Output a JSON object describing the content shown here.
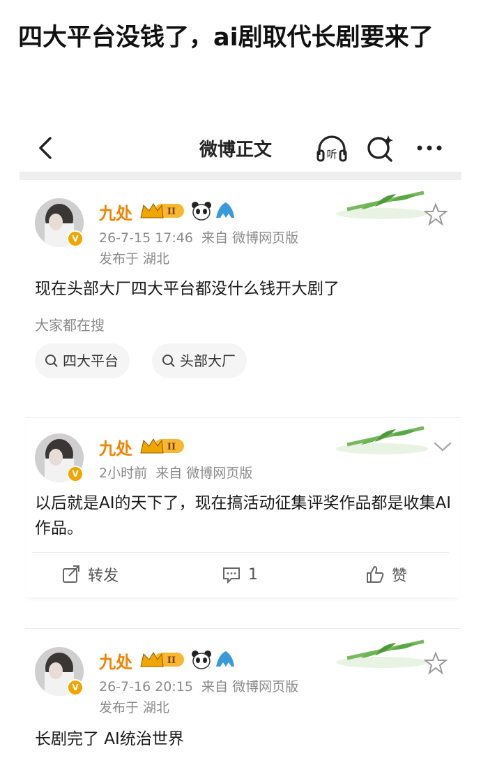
{
  "headline": "四大平台没钱了，ai剧取代长剧要来了",
  "topbar": {
    "title": "微博正文",
    "listen_icon_text": "听"
  },
  "chips_label": "大家都在搜",
  "posts": [
    {
      "username": "九处",
      "level": "II",
      "time": "26-7-15 17:46",
      "source": "来自 微博网页版",
      "location": "发布于 湖北",
      "text": "现在头部大厂四大平台都没什么钱开大剧了",
      "search_chips": [
        "四大平台",
        "头部大厂"
      ]
    },
    {
      "username": "九处",
      "level": "II",
      "time": "2小时前",
      "source": "来自 微博网页版",
      "text": "以后就是AI的天下了，现在搞活动征集评奖作品都是收集AI作品。",
      "actions": {
        "repost": "转发",
        "comment_count": "1",
        "like": "赞"
      }
    },
    {
      "username": "九处",
      "level": "II",
      "time": "26-7-16 20:15",
      "source": "来自 微博网页版",
      "location": "发布于 湖北",
      "text": "长剧完了 AI统治世界"
    }
  ],
  "colors": {
    "username": "#f08300",
    "meta": "#8a8a8a",
    "badge": "#f0a500"
  }
}
